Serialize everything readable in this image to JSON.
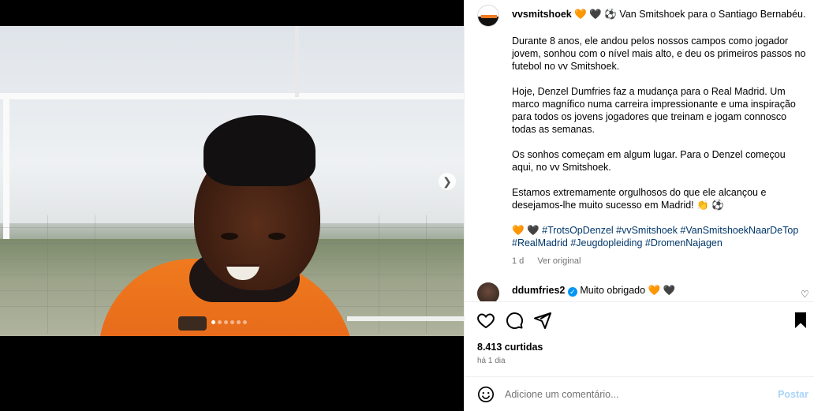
{
  "post": {
    "username": "vvsmitshoek",
    "title_emoji_1": "🧡",
    "title_emoji_2": "🖤",
    "title_emoji_3": "⚽",
    "title_text": "Van Smitshoek para o Santiago Bernabéu.",
    "paragraph_1": "Durante 8 anos, ele andou pelos nossos campos como jogador jovem, sonhou com o nível mais alto, e deu os primeiros passos no futebol no vv Smitshoek.",
    "paragraph_2": "Hoje, Denzel Dumfries faz a mudança para o Real Madrid. Um marco magnífico numa carreira impressionante e uma inspiração para todos os jovens jogadores que treinam e jogam connosco todas as semanas.",
    "paragraph_3": "Os sonhos começam em algum lugar. Para o Denzel começou aqui, no vv Smitshoek.",
    "paragraph_4": "Estamos extremamente orgulhosos do que ele alcançou e desejamos-lhe muito sucesso em Madrid! 👏 ⚽",
    "hashtag_emoji_1": "🧡",
    "hashtag_emoji_2": "🖤",
    "hashtags": "#TrotsOpDenzel #vvSmitshoek #VanSmitshoekNaarDeTop #RealMadrid #Jeugdopleiding #DromenNajagen",
    "age": "1 d",
    "see_original": "Ver original",
    "likes": "8.413 curtidas",
    "time": "há 1 dia",
    "carousel_dots": 6,
    "active_dot": 1
  },
  "comment": {
    "username": "ddumfries2",
    "verified": "✓",
    "text": "Muito obrigado",
    "emoji_1": "🧡",
    "emoji_2": "🖤"
  },
  "comment_bar": {
    "placeholder": "Adicione um comentário...",
    "post_label": "Postar"
  },
  "icons": {
    "like": "heart-icon",
    "comment": "comment-icon",
    "share": "share-icon",
    "save": "bookmark-icon",
    "emoji": "emoji-icon",
    "next": "chevron-right-icon"
  }
}
